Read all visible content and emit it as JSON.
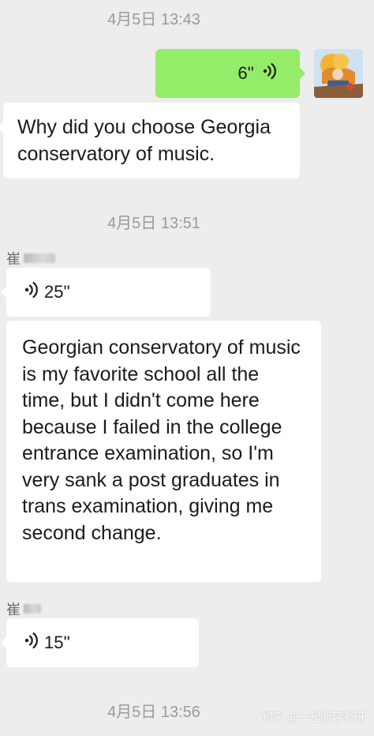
{
  "timestamps": [
    "4月5日 13:43",
    "4月5日 13:51",
    "4月5日 13:56"
  ],
  "messages": {
    "sent_voice": {
      "duration": "6''"
    },
    "question_text": "Why did you choose Georgia conservatory of music.",
    "sender_name_1": "崔",
    "voice_1": {
      "duration": "25''"
    },
    "answer_text": "Georgian conservatory of music is my favorite school all the time, but I didn't come here because I failed in the college entrance examination, so I'm very sank a post graduates in trans examination, giving me second change.",
    "sender_name_2": "崔",
    "voice_2": {
      "duration": "15''"
    }
  },
  "watermark": "知乎 @一起浙音考研",
  "colors": {
    "background": "#ededed",
    "sent_bubble": "#95ec69",
    "received_bubble": "#ffffff",
    "timestamp": "#9b9b9b"
  },
  "icons": [
    "voice-wave-icon",
    "user-avatar-icon"
  ]
}
